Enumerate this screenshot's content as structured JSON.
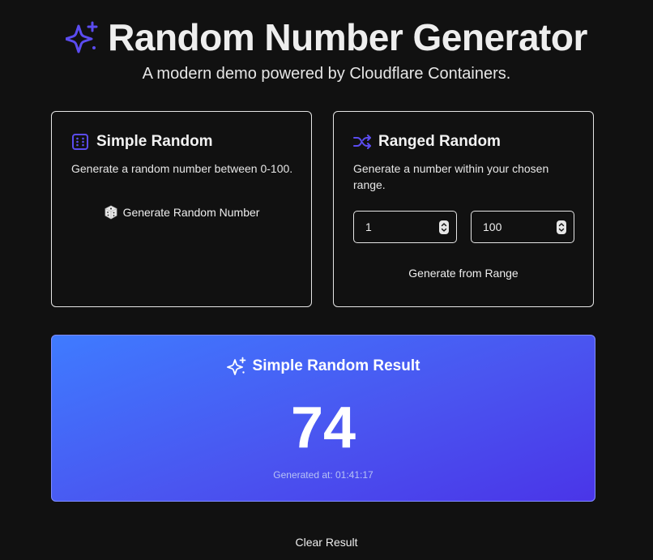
{
  "header": {
    "title": "Random Number Generator",
    "subtitle": "A modern demo powered by Cloudflare Containers.",
    "icon": "sparkles-icon"
  },
  "simple_card": {
    "icon": "dice-grid-icon",
    "title": "Simple Random",
    "description": "Generate a random number between 0-100.",
    "button_label": "Generate Random Number",
    "button_icon": "dice-emoji-icon"
  },
  "ranged_card": {
    "icon": "shuffle-icon",
    "title": "Ranged Random",
    "description": "Generate a number within your chosen range.",
    "min_value": "1",
    "max_value": "100",
    "button_label": "Generate from Range"
  },
  "result": {
    "icon": "sparkles-icon",
    "title": "Simple Random Result",
    "value": "74",
    "timestamp": "Generated at: 01:41:17"
  },
  "clear_button_label": "Clear Result",
  "colors": {
    "accent": "#5b4cf0",
    "background": "#111111",
    "result_gradient_start": "#3f7bff",
    "result_gradient_end": "#4a35e8"
  }
}
